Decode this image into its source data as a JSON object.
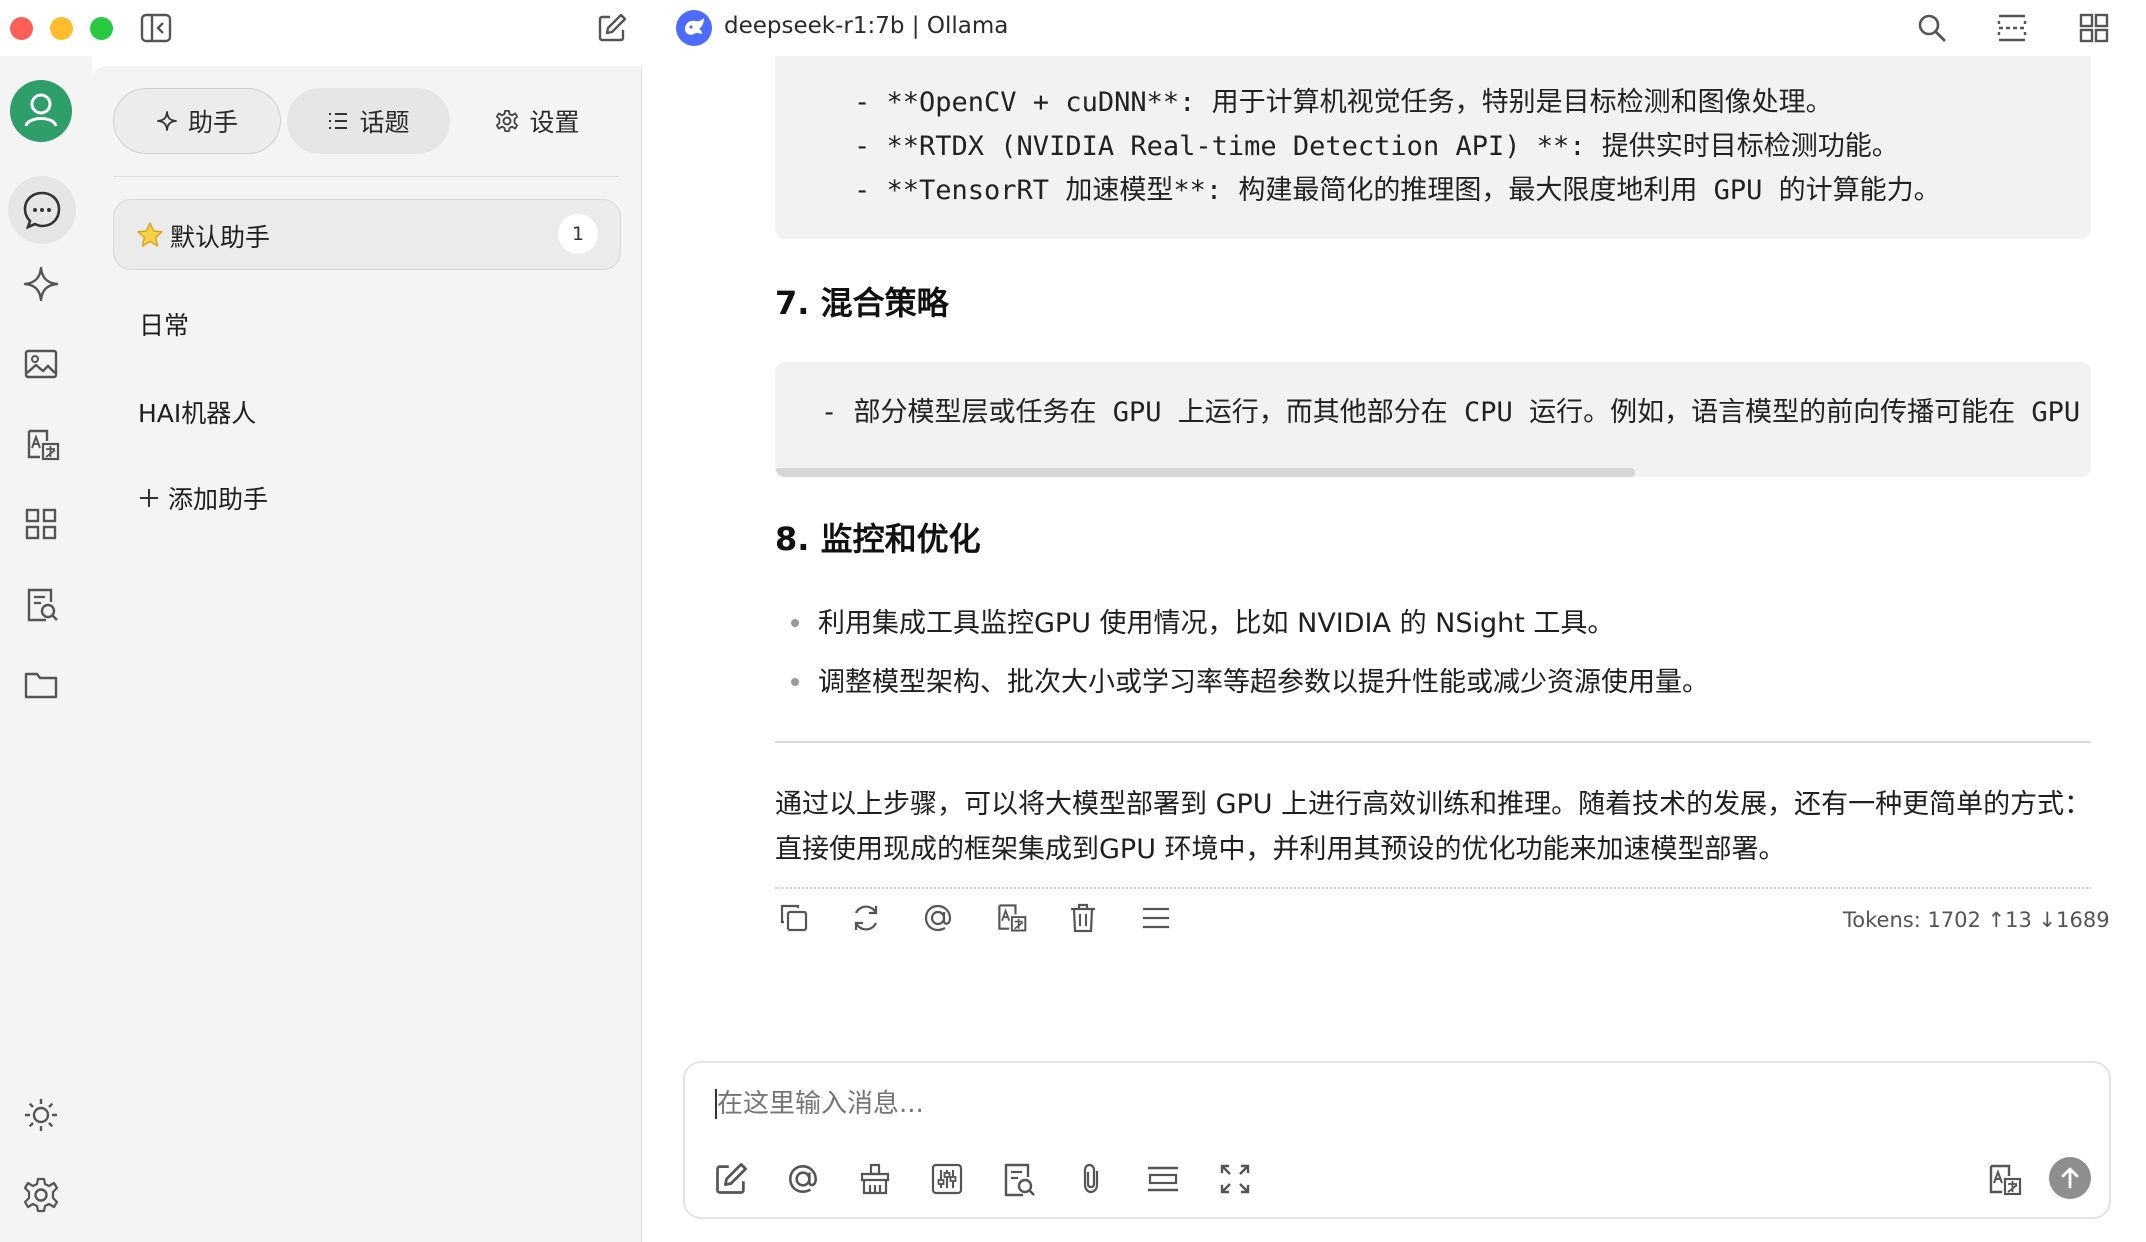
{
  "window": {
    "title": "deepseek-r1:7b | Ollama",
    "colors": {
      "close": "#ff5f57",
      "minimize": "#febc2e",
      "maximize": "#28c840",
      "accent": "#2e9e6a"
    }
  },
  "sidebar": {
    "tabs": [
      {
        "label": "助手",
        "icon": "sparkle-icon"
      },
      {
        "label": "话题",
        "icon": "list-icon"
      },
      {
        "label": "设置",
        "icon": "gear-icon"
      }
    ],
    "assistants": [
      {
        "label": "默认助手",
        "icon": "star-icon",
        "badge": "1"
      },
      {
        "label": "日常"
      },
      {
        "label": "HAI机器人"
      }
    ],
    "add_label": "添加助手"
  },
  "chat": {
    "code_top": [
      "- **OpenCV + cuDNN**: 用于计算机视觉任务，特别是目标检测和图像处理。",
      "- **RTDX (NVIDIA Real-time Detection API) **: 提供实时目标检测功能。",
      "- **TensorRT 加速模型**: 构建最简化的推理图，最大限度地利用 GPU 的计算能力。"
    ],
    "heading7": "7. 混合策略",
    "code_mid": "- 部分模型层或任务在 GPU 上运行，而其他部分在 CPU 运行。例如，语言模型的前向传播可能在 GPU 上",
    "heading8": "8. 监控和优化",
    "bullets": [
      "利用集成工具监控GPU 使用情况，比如 NVIDIA 的 NSight 工具。",
      "调整模型架构、批次大小或学习率等超参数以提升性能或减少资源使用量。"
    ],
    "summary": "通过以上步骤，可以将大模型部署到 GPU 上进行高效训练和推理。随着技术的发展，还有一种更简单的方式：直接使用现成的框架集成到GPU 环境中，并利用其预设的优化功能来加速模型部署。",
    "tokens": "Tokens: 1702 ↑13 ↓1689"
  },
  "input": {
    "placeholder": "在这里输入消息..."
  }
}
